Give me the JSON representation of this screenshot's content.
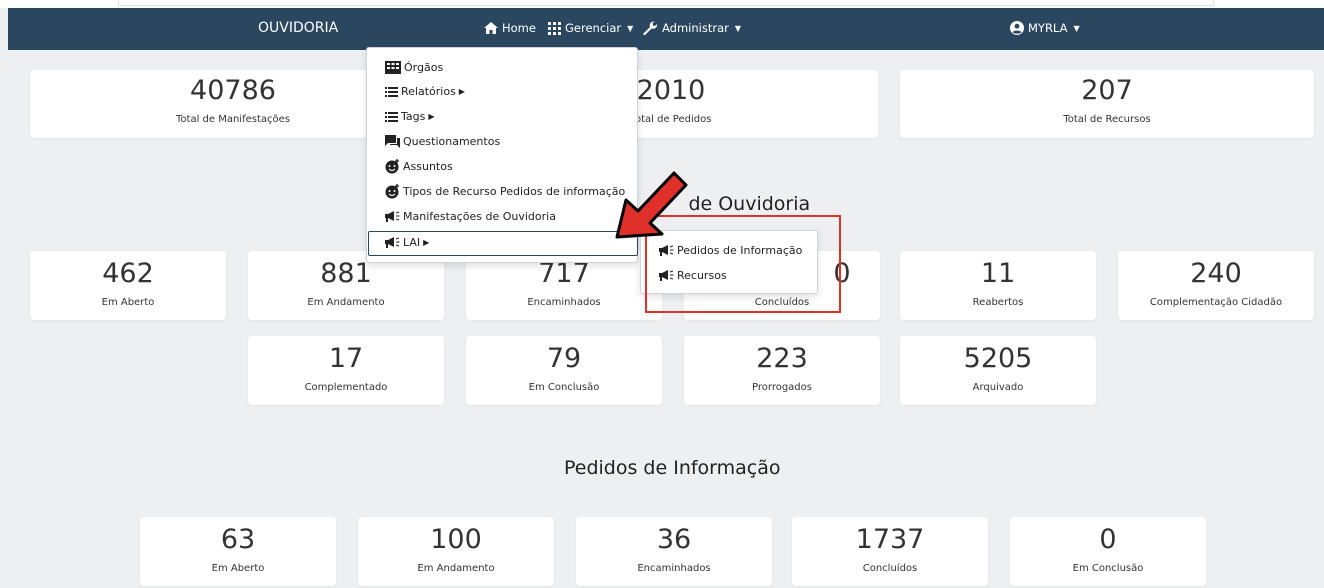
{
  "navbar": {
    "brand": "OUVIDORIA",
    "home_label": "Home",
    "gerenciar_label": "Gerenciar",
    "administrar_label": "Administrar",
    "user_label": "MYRLA"
  },
  "summary_cards": [
    {
      "value": "40786",
      "label": "Total de Manifestações"
    },
    {
      "value": "2010",
      "label": "Total de Pedidos"
    },
    {
      "value": "207",
      "label": "Total de Recursos"
    }
  ],
  "ouvidoria_section": {
    "title": "Manifestações de Ouvidoria",
    "title_visible": "de Ouvidoria",
    "row1": [
      {
        "value": "462",
        "label": "Em Aberto"
      },
      {
        "value": "881",
        "label": "Em Andamento"
      },
      {
        "value": "717",
        "label": "Encaminhados"
      },
      {
        "value": "0",
        "label": "Concluídos"
      },
      {
        "value": "11",
        "label": "Reabertos"
      },
      {
        "value": "240",
        "label": "Complementação Cidadão"
      }
    ],
    "row2": [
      {
        "value": "17",
        "label": "Complementado"
      },
      {
        "value": "79",
        "label": "Em Conclusão"
      },
      {
        "value": "223",
        "label": "Prorrogados"
      },
      {
        "value": "5205",
        "label": "Arquivado"
      }
    ]
  },
  "pedidos_section": {
    "title": "Pedidos de Informação",
    "cards": [
      {
        "value": "63",
        "label": "Em Aberto"
      },
      {
        "value": "100",
        "label": "Em Andamento"
      },
      {
        "value": "36",
        "label": "Encaminhados"
      },
      {
        "value": "1737",
        "label": "Concluídos"
      },
      {
        "value": "0",
        "label": "Em Conclusão"
      }
    ]
  },
  "gerenciar_menu": {
    "items": [
      {
        "label": "Órgãos",
        "icon": "building-icon"
      },
      {
        "label": "Relatórios",
        "icon": "list-icon",
        "has_submenu": true
      },
      {
        "label": "Tags",
        "icon": "list-icon",
        "has_submenu": true
      },
      {
        "label": "Questionamentos",
        "icon": "comments-icon"
      },
      {
        "label": "Assuntos",
        "icon": "face-plus-icon"
      },
      {
        "label": "Tipos de Recurso Pedidos de informação",
        "icon": "face-plus-icon"
      },
      {
        "label": "Manifestações de Ouvidoria",
        "icon": "megaphone-icon"
      },
      {
        "label": "LAI",
        "icon": "megaphone-icon",
        "has_submenu": true
      }
    ]
  },
  "lai_submenu": {
    "items": [
      {
        "label": "Pedidos de Informação",
        "icon": "megaphone-icon"
      },
      {
        "label": "Recursos",
        "icon": "megaphone-icon"
      }
    ]
  },
  "colors": {
    "navbar_bg": "#2b4760",
    "page_bg": "#eeeff1",
    "annotation_red": "#e0302a"
  }
}
